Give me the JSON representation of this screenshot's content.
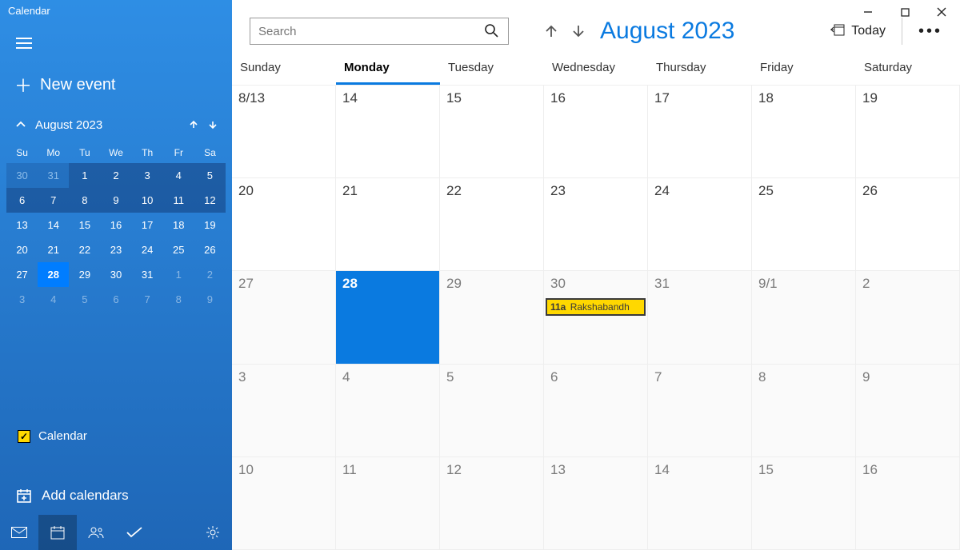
{
  "app": {
    "title": "Calendar"
  },
  "sidebar": {
    "new_event_label": "New event",
    "mini_month_label": "August 2023",
    "dow": [
      "Su",
      "Mo",
      "Tu",
      "We",
      "Th",
      "Fr",
      "Sa"
    ],
    "cells": [
      {
        "n": "30",
        "dim": true,
        "dark": true
      },
      {
        "n": "31",
        "dim": true,
        "dark": true
      },
      {
        "n": "1",
        "dark": true
      },
      {
        "n": "2",
        "dark": true
      },
      {
        "n": "3",
        "dark": true
      },
      {
        "n": "4",
        "dark": true
      },
      {
        "n": "5",
        "dark": true
      },
      {
        "n": "6",
        "dark": true
      },
      {
        "n": "7",
        "dark": true
      },
      {
        "n": "8",
        "dark": true
      },
      {
        "n": "9",
        "dark": true
      },
      {
        "n": "10",
        "dark": true
      },
      {
        "n": "11",
        "dark": true
      },
      {
        "n": "12",
        "dark": true
      },
      {
        "n": "13"
      },
      {
        "n": "14"
      },
      {
        "n": "15"
      },
      {
        "n": "16"
      },
      {
        "n": "17"
      },
      {
        "n": "18"
      },
      {
        "n": "19"
      },
      {
        "n": "20"
      },
      {
        "n": "21"
      },
      {
        "n": "22"
      },
      {
        "n": "23"
      },
      {
        "n": "24"
      },
      {
        "n": "25"
      },
      {
        "n": "26"
      },
      {
        "n": "27"
      },
      {
        "n": "28",
        "today": true
      },
      {
        "n": "29"
      },
      {
        "n": "30"
      },
      {
        "n": "31"
      },
      {
        "n": "1",
        "dim": true
      },
      {
        "n": "2",
        "dim": true
      },
      {
        "n": "3",
        "dim": true
      },
      {
        "n": "4",
        "dim": true
      },
      {
        "n": "5",
        "dim": true
      },
      {
        "n": "6",
        "dim": true
      },
      {
        "n": "7",
        "dim": true
      },
      {
        "n": "8",
        "dim": true
      },
      {
        "n": "9",
        "dim": true
      }
    ],
    "calendar_check_label": "Calendar",
    "add_calendars_label": "Add calendars"
  },
  "toolbar": {
    "search_placeholder": "Search",
    "month_title": "August 2023",
    "today_label": "Today"
  },
  "main_grid": {
    "dow": [
      "Sunday",
      "Monday",
      "Tuesday",
      "Wednesday",
      "Thursday",
      "Friday",
      "Saturday"
    ],
    "active_dow_index": 1,
    "days": [
      {
        "label": "8/13"
      },
      {
        "label": "14"
      },
      {
        "label": "15"
      },
      {
        "label": "16"
      },
      {
        "label": "17"
      },
      {
        "label": "18"
      },
      {
        "label": "19"
      },
      {
        "label": "20"
      },
      {
        "label": "21"
      },
      {
        "label": "22"
      },
      {
        "label": "23"
      },
      {
        "label": "24"
      },
      {
        "label": "25"
      },
      {
        "label": "26"
      },
      {
        "label": "27",
        "out": true
      },
      {
        "label": "28",
        "today": true
      },
      {
        "label": "29",
        "out": true
      },
      {
        "label": "30",
        "out": true,
        "event": {
          "time": "11a",
          "title": "Rakshabandh"
        }
      },
      {
        "label": "31",
        "out": true
      },
      {
        "label": "9/1",
        "out": true
      },
      {
        "label": "2",
        "out": true
      },
      {
        "label": "3",
        "out": true
      },
      {
        "label": "4",
        "out": true
      },
      {
        "label": "5",
        "out": true
      },
      {
        "label": "6",
        "out": true
      },
      {
        "label": "7",
        "out": true
      },
      {
        "label": "8",
        "out": true
      },
      {
        "label": "9",
        "out": true
      },
      {
        "label": "10",
        "out": true
      },
      {
        "label": "11",
        "out": true
      },
      {
        "label": "12",
        "out": true
      },
      {
        "label": "13",
        "out": true
      },
      {
        "label": "14",
        "out": true
      },
      {
        "label": "15",
        "out": true
      },
      {
        "label": "16",
        "out": true
      }
    ]
  }
}
